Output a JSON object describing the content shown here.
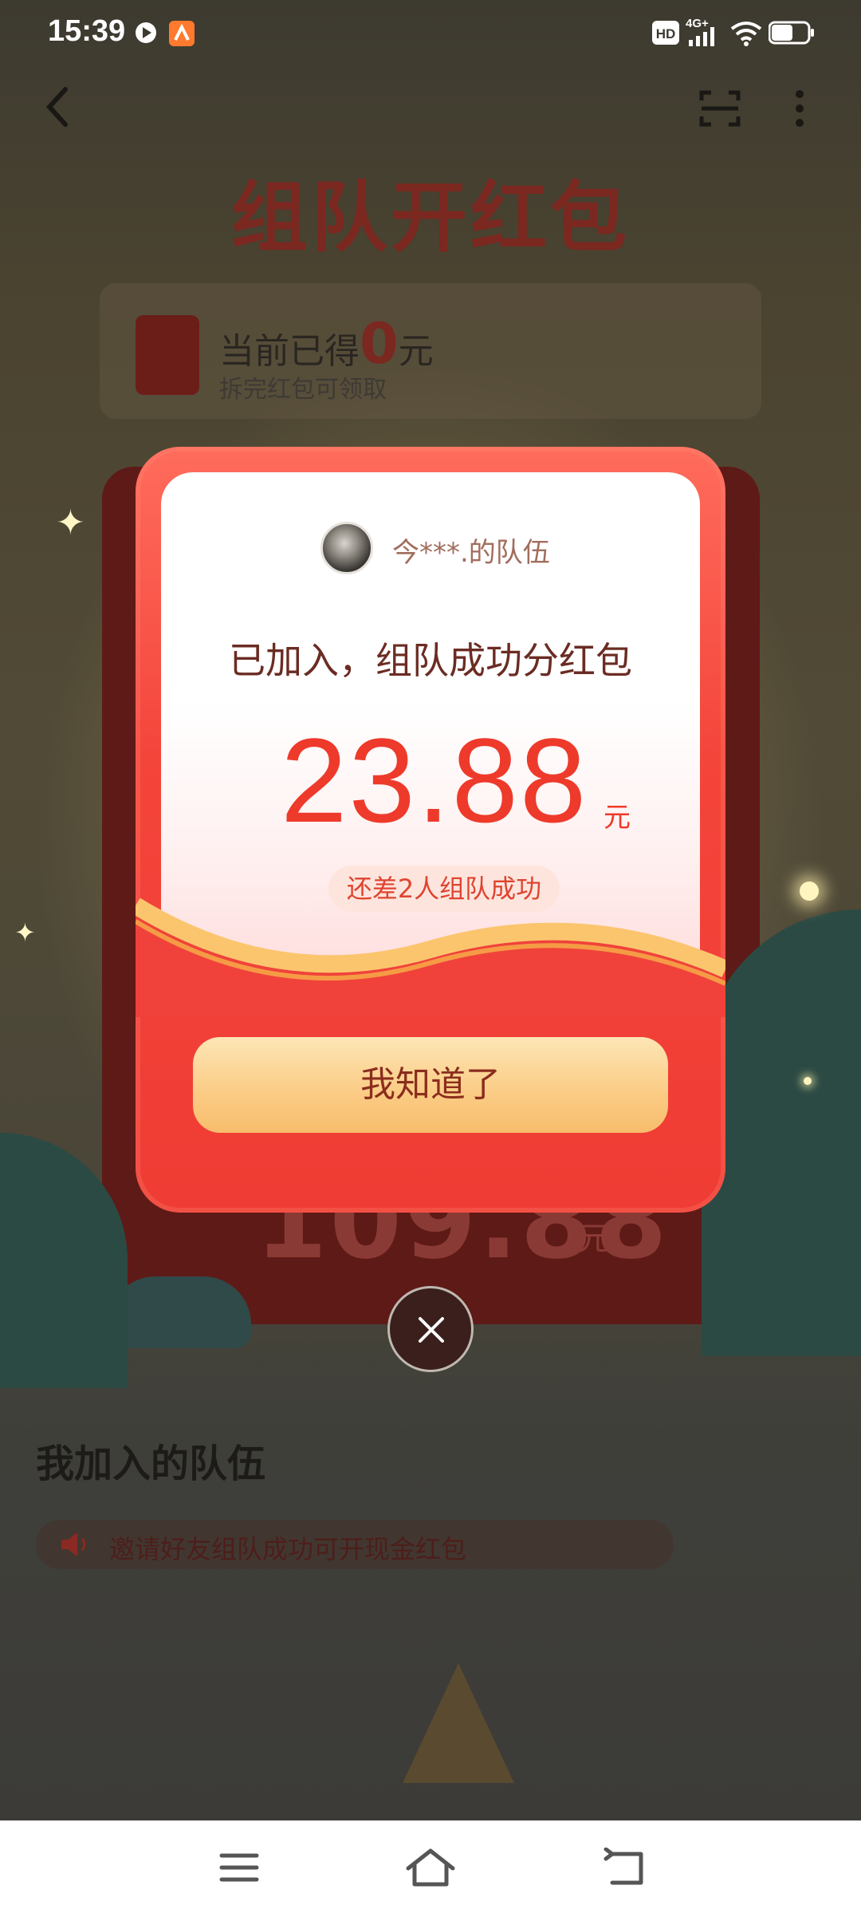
{
  "status_bar": {
    "time": "15:39",
    "network": "4G+",
    "hd": "HD"
  },
  "header": {
    "back_icon": "chevron-left-icon",
    "scan_icon": "scan-icon",
    "more_icon": "more-vertical-icon"
  },
  "background_page": {
    "title": "组队开红包",
    "earned_prefix": "当前已得",
    "earned_value": "0",
    "earned_unit": "元",
    "earned_hint": "拆完红包可领取",
    "big_amount": "109.88",
    "big_amount_unit": "元",
    "my_teams_title": "我加入的队伍",
    "notice_text": "邀请好友组队成功可开现金红包"
  },
  "modal": {
    "team_name": "今***.的队伍",
    "joined_text": "已加入，组队成功分红包",
    "amount": "23.88",
    "amount_unit": "元",
    "remaining_text": "还差2人组队成功",
    "confirm_label": "我知道了",
    "close_icon": "close-icon"
  },
  "nav_bar": {
    "menu_icon": "menu-icon",
    "home_icon": "home-icon",
    "back_icon": "back-icon"
  },
  "colors": {
    "accent_red": "#ee3a2b",
    "button_gold": "#fbcb84",
    "title_brown": "#6b2c23"
  }
}
